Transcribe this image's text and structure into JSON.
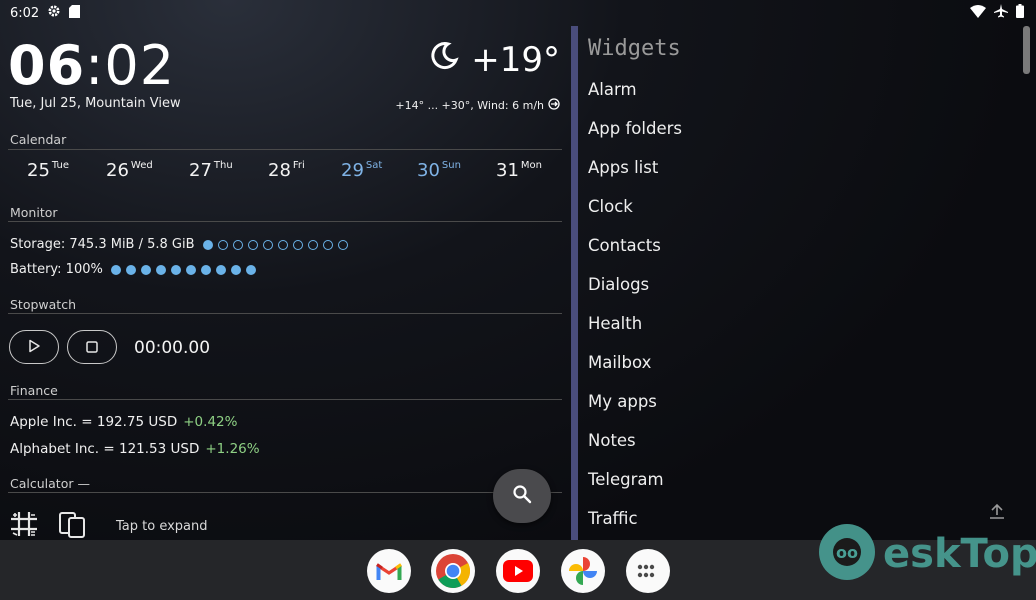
{
  "status": {
    "time": "6:02"
  },
  "clock": {
    "hours": "06",
    "sep": ":",
    "minutes": "02",
    "date": "Tue, Jul 25, Mountain View"
  },
  "weather": {
    "temp": "+19°",
    "details": "+14° ... +30°, Wind: 6 m/h"
  },
  "calendar": {
    "title": "Calendar",
    "days": [
      {
        "num": "25",
        "dow": "Tue"
      },
      {
        "num": "26",
        "dow": "Wed"
      },
      {
        "num": "27",
        "dow": "Thu"
      },
      {
        "num": "28",
        "dow": "Fri"
      },
      {
        "num": "29",
        "dow": "Sat"
      },
      {
        "num": "30",
        "dow": "Sun"
      },
      {
        "num": "31",
        "dow": "Mon"
      }
    ]
  },
  "monitor": {
    "title": "Monitor",
    "storage": "Storage: 745.3 MiB / 5.8 GiB",
    "storage_fill": 0.1,
    "battery": "Battery: 100%",
    "battery_fill": 1.0
  },
  "stopwatch": {
    "title": "Stopwatch",
    "time": "00:00.00"
  },
  "finance": {
    "title": "Finance",
    "rows": [
      {
        "label": "Apple Inc. = 192.75 USD",
        "change": "+0.42%"
      },
      {
        "label": "Alphabet Inc. = 121.53 USD",
        "change": "+1.26%"
      }
    ]
  },
  "calculator": {
    "title": "Calculator —",
    "tap": "Tap to expand"
  },
  "widgets": {
    "title": "Widgets",
    "items": [
      "Alarm",
      "App folders",
      "Apps list",
      "Clock",
      "Contacts",
      "Dialogs",
      "Health",
      "Mailbox",
      "My apps",
      "Notes",
      "Telegram",
      "Traffic"
    ]
  },
  "dock": {
    "apps": [
      "gmail-icon",
      "chrome-icon",
      "youtube-icon",
      "photos-icon",
      "app-drawer-icon"
    ]
  },
  "watermark": {
    "text": "eskTop"
  },
  "colors": {
    "accent": "#6ab2e8",
    "positive": "#8ed084",
    "divider": "#4a4d7c",
    "watermark": "#49a096"
  }
}
